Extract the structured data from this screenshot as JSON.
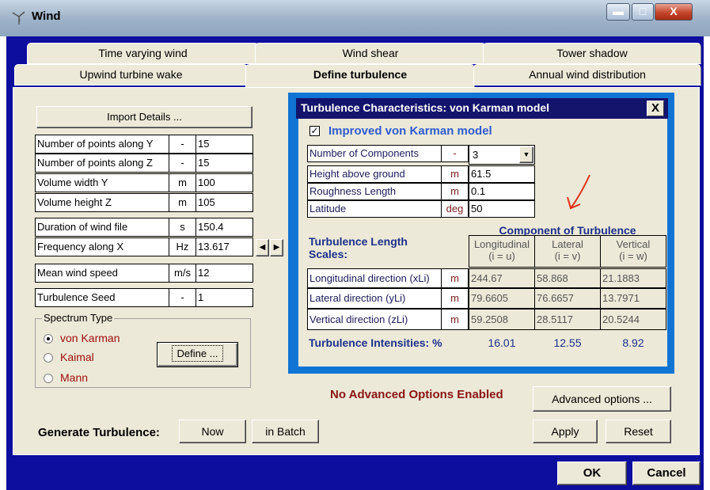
{
  "window": {
    "title": "Wind",
    "icon": "wind-turbine-icon",
    "minimize_icon": "minimize-icon",
    "maximize_icon": "maximize-icon",
    "close_label": "X"
  },
  "tabs_row1": [
    "Time varying wind",
    "Wind shear",
    "Tower shadow"
  ],
  "tabs_row2": [
    "Upwind turbine wake",
    "Define turbulence",
    "Annual wind distribution"
  ],
  "active_tab": "Define turbulence",
  "import_button": "Import Details ...",
  "params": [
    {
      "label": "Number of points along Y",
      "unit": "-",
      "value": "15"
    },
    {
      "label": "Number of points along Z",
      "unit": "-",
      "value": "15"
    },
    {
      "label": "Volume width Y",
      "unit": "m",
      "value": "100"
    },
    {
      "label": "Volume height Z",
      "unit": "m",
      "value": "105"
    },
    {
      "label": "Duration of wind file",
      "unit": "s",
      "value": "150.4"
    },
    {
      "label": "Frequency along X",
      "unit": "Hz",
      "value": "13.617"
    },
    {
      "label": "Mean wind speed",
      "unit": "m/s",
      "value": "12"
    },
    {
      "label": "Turbulence Seed",
      "unit": "-",
      "value": "1"
    }
  ],
  "spectrum": {
    "legend": "Spectrum Type",
    "options": [
      "von Karman",
      "Kaimal",
      "Mann"
    ],
    "selected": "von Karman",
    "define_button": "Define ..."
  },
  "turbulence_dialog": {
    "title": "Turbulence Characteristics: von Karman model",
    "close_label": "X",
    "improved_label": "Improved von Karman model",
    "improved_checked": true,
    "settings": [
      {
        "label": "Number of Components",
        "unit": "-",
        "value": "3"
      },
      {
        "label": "Height above ground",
        "unit": "m",
        "value": "61.5"
      },
      {
        "label": "Roughness Length",
        "unit": "m",
        "value": "0.1"
      },
      {
        "label": "Latitude",
        "unit": "deg",
        "value": "50"
      }
    ],
    "length_scales_label": "Turbulence Length Scales:",
    "component_header": "Component of Turbulence",
    "columns": [
      {
        "name": "Longitudinal",
        "sub": "(i = u)"
      },
      {
        "name": "Lateral",
        "sub": "(i = v)"
      },
      {
        "name": "Vertical",
        "sub": "(i = w)"
      }
    ],
    "rows": [
      {
        "label": "Longitudinal direction (xLi)",
        "unit": "m",
        "values": [
          "244.67",
          "58.868",
          "21.1883"
        ]
      },
      {
        "label": "Lateral direction (yLi)",
        "unit": "m",
        "values": [
          "79.6605",
          "76.6657",
          "13.7971"
        ]
      },
      {
        "label": "Vertical direction (zLi)",
        "unit": "m",
        "values": [
          "59.2508",
          "28.5117",
          "20.5244"
        ]
      }
    ],
    "intensities_label": "Turbulence Intensities: %",
    "intensities": [
      "16.01",
      "12.55",
      "8.92"
    ]
  },
  "advanced": {
    "status": "No Advanced Options Enabled",
    "button": "Advanced options ..."
  },
  "generate": {
    "label": "Generate Turbulence:",
    "now": "Now",
    "batch": "in Batch"
  },
  "apply": "Apply",
  "reset": "Reset",
  "ok": "OK",
  "cancel": "Cancel",
  "colors": {
    "frame_blue": "#0d0d9e",
    "dialog_blue": "#0f74d4",
    "annotation_arrow": "#e0301a"
  }
}
